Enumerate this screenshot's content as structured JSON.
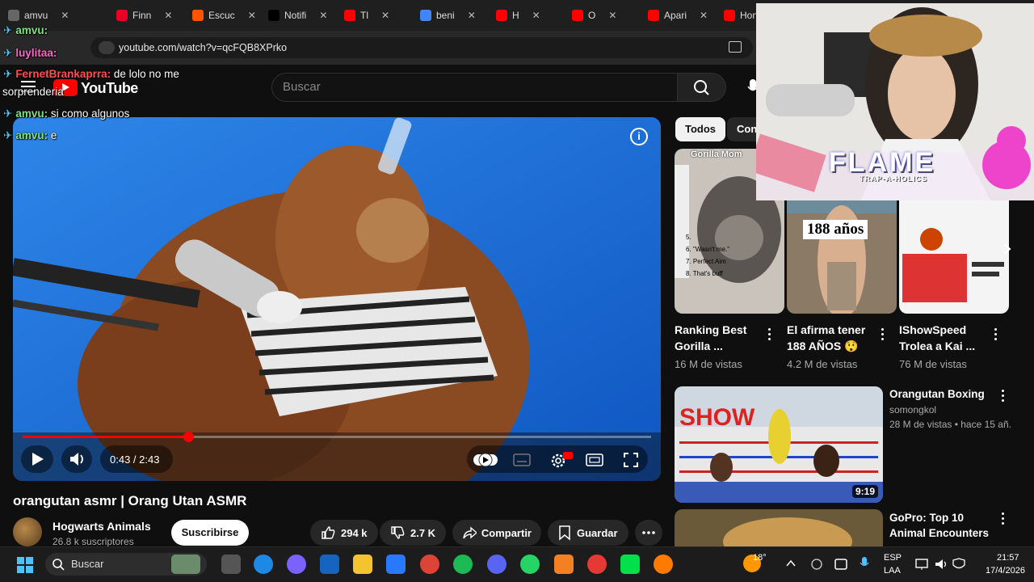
{
  "browser": {
    "tabs": [
      {
        "label": "amvu",
        "color": "#666666"
      },
      {
        "label": "Finn",
        "color": "#e60023"
      },
      {
        "label": "Escuc",
        "color": "#ff5500"
      },
      {
        "label": "Notifi",
        "color": "#000000"
      },
      {
        "label": "Tl",
        "color": "#ff0000"
      },
      {
        "label": "beni",
        "color": "#4285f4"
      },
      {
        "label": "H",
        "color": "#ff0000"
      },
      {
        "label": "O",
        "color": "#ff0000"
      },
      {
        "label": "Apari",
        "color": "#ff0000"
      },
      {
        "label": "Hon",
        "color": "#ff0000"
      }
    ],
    "url": "youtube.com/watch?v=qcFQB8XPrko"
  },
  "chat": [
    {
      "user": "amvu:",
      "text": ""
    },
    {
      "user": "luylitaa:",
      "text": ""
    },
    {
      "user": "FernetBrankaprra:",
      "text": "de lolo no me"
    },
    {
      "user": "",
      "text": "sorprenderia"
    },
    {
      "user": "amvu:",
      "text": "si como algunos"
    },
    {
      "user": "amvu:",
      "text": "e"
    }
  ],
  "youtube": {
    "logo_text": "YouTube",
    "search_placeholder": "Buscar",
    "player": {
      "current_time": "0:43 / 2:43",
      "progress_fraction": 0.2638
    },
    "video_title": "orangutan asmr | Orang Utan ASMR",
    "channel": {
      "name": "Hogwarts Animals",
      "subscribers": "26.8 k suscriptores"
    },
    "subscribe_label": "Suscribirse",
    "likes": "294 k",
    "dislikes": "2.7 K",
    "share_label": "Compartir",
    "save_label": "Guardar",
    "chips": [
      "Todos",
      "Con"
    ],
    "shorts": [
      {
        "title": "Ranking Best Gorilla ...",
        "views": "16 M de vistas",
        "overlay": "Gorilla Mom"
      },
      {
        "title": "El afirma tener 188 AÑOS 😲",
        "views": "4.2 M de vistas",
        "overlay": "188 años"
      },
      {
        "title": "IShowSpeed Trolea a Kai ...",
        "views": "76 M de vistas",
        "overlay": ""
      }
    ],
    "related": [
      {
        "title": "Orangutan Boxing",
        "channel": "somongkol",
        "meta": "28 M de vistas • hace 15 añ...",
        "duration": "9:19"
      },
      {
        "title": "GoPro: Top 10 Animal Encounters",
        "channel": "",
        "meta": "",
        "duration": ""
      }
    ]
  },
  "webcam": {
    "banner_text": "FLAME",
    "banner_subtext": "TRAP-A-HOLICS"
  },
  "taskbar": {
    "search_label": "Buscar",
    "weather": "18°",
    "language_top": "ESP",
    "language_bottom": "LAA",
    "time": "21:57",
    "date": "17/4/2026"
  }
}
